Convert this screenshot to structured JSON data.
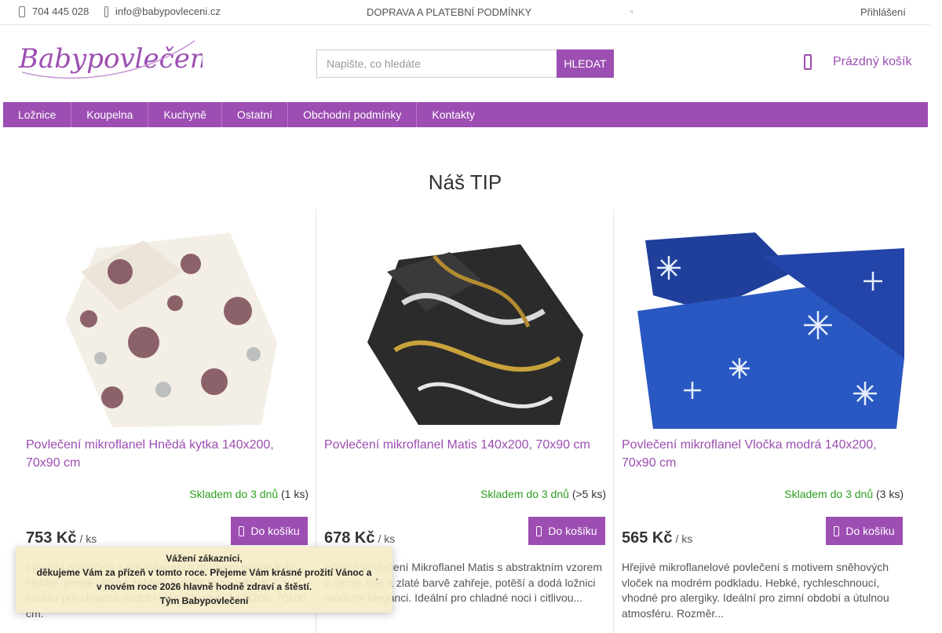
{
  "topbar": {
    "phone": "704 445 028",
    "email": "info@babypovleceni.cz",
    "info_link": "DOPRAVA A PLATEBNÍ PODMÍNKY",
    "login": "Přihlášení"
  },
  "header": {
    "logo_text": "Babypovlečení",
    "search_placeholder": "Napište, co hledáte",
    "search_button": "HLEDAT",
    "cart_label": "Prázdný košík"
  },
  "nav": [
    "Ložnice",
    "Koupelna",
    "Kuchyně",
    "Ostatní",
    "Obchodní podmínky",
    "Kontakty"
  ],
  "section_title": "Náš TIP",
  "products": [
    {
      "name": "Povlečení mikroflanel Hnědá kytka 140x200, 70x90 cm",
      "stock": "Skladem do 3 dnů",
      "qty": "(1 ks)",
      "price": "753 Kč",
      "unit": "/ ks",
      "buy": "Do košíku",
      "desc": "Luxusní povlečení z mikroflanelu s motivem hnědé kytky. Hebké, jemné vlákno zahřeje a dodá pocit pohodlí. Ideální pro chladné období roku. Rozměr 140x200, 70x90 cm."
    },
    {
      "name": "Povlečení mikroflanel Matis 140x200, 70x90 cm",
      "stock": "Skladem do 3 dnů",
      "qty": "(>5 ks)",
      "price": "678 Kč",
      "unit": "/ ks",
      "buy": "Do košíku",
      "desc": "Hřejivé povlečení Mikroflanel Matis s abstraktním vzorem v černé, bílé a zlaté barvě zahřeje, potěší a dodá ložnici moderní eleganci. Ideální pro chladné noci i citlivou..."
    },
    {
      "name": "Povlečení mikroflanel Vločka modrá 140x200, 70x90 cm",
      "stock": "Skladem do 3 dnů",
      "qty": "(3 ks)",
      "price": "565 Kč",
      "unit": "/ ks",
      "buy": "Do košíku",
      "desc": "Hřejivé mikroflanelové povlečení s motivem sněhových vloček na modrém podkladu. Hebké, rychleschnoucí, vhodné pro alergiky. Ideální pro zimní období a útulnou atmosféru. Rozměr..."
    }
  ],
  "popup": {
    "line1": "Vážení zákazníci,",
    "line2": "děkujeme Vám za přízeň v tomto roce. Přejeme Vám krásné prožití Vánoc a",
    "line3": "v novém roce 2026 hlavně hodně zdraví a štěstí.",
    "line4": "Tým Babypovlečení"
  },
  "colors": {
    "accent": "#9c4eb2",
    "stock_green": "#2c9e1e"
  }
}
